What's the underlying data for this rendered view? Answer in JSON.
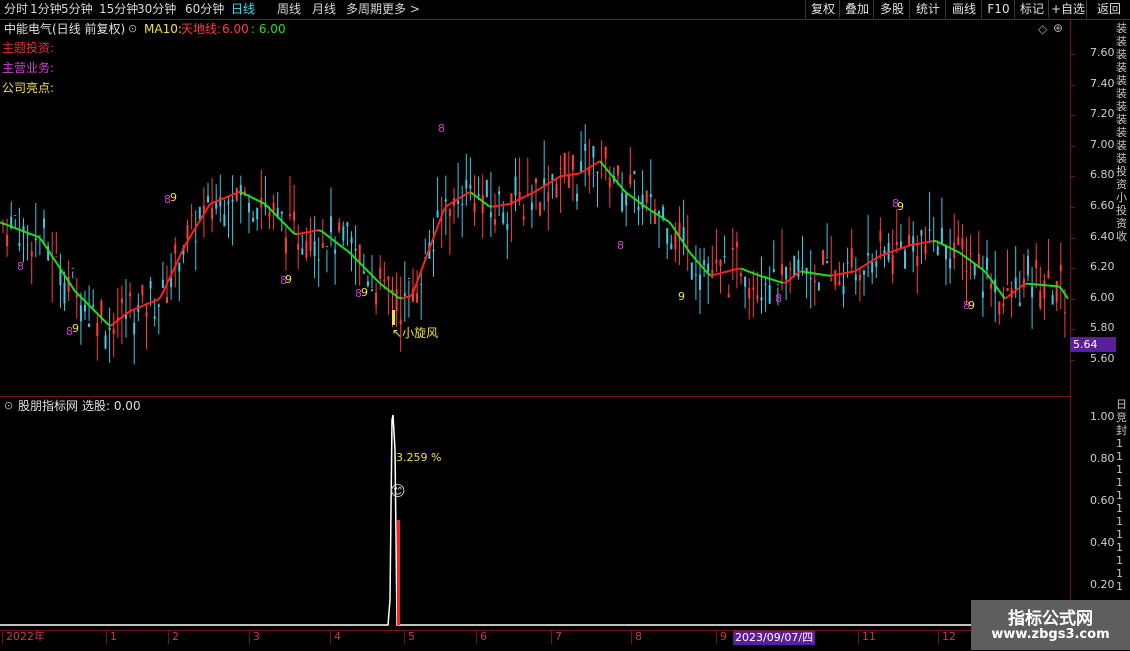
{
  "period_tabs": [
    "分时",
    "1分钟",
    "5分钟",
    "15分钟",
    "30分钟",
    "60分钟",
    "日线",
    "周线",
    "月线",
    "多周期",
    "更多 >"
  ],
  "active_tab_index": 6,
  "right_buttons": [
    "复权",
    "叠加",
    "多股",
    "统计",
    "画线",
    "F10",
    "标记",
    "+自选",
    "返回"
  ],
  "chart_header": {
    "stock": "中能电气(日线 前复权)",
    "indicator": "MA10:",
    "line_name": "天地线:",
    "value_red": "6.00",
    "value_green": ": 6.00"
  },
  "info_labels": [
    {
      "text": "主题投资:",
      "color": "#e03030"
    },
    {
      "text": "主营业务:",
      "color": "#d040d0"
    },
    {
      "text": "公司亮点:",
      "color": "#f0e040"
    }
  ],
  "price_ticks": [
    "7.60",
    "7.40",
    "7.20",
    "7.00",
    "6.80",
    "6.60",
    "6.40",
    "6.20",
    "6.00",
    "5.80",
    "5.60"
  ],
  "last_price": "5.64",
  "annotation": "小旋风",
  "lower_panel": {
    "title": "股朋指标网",
    "select_label": "选股: 0.00",
    "pct_label": "3.259 %",
    "ticks": [
      "1.00",
      "0.80",
      "0.60",
      "0.40",
      "0.20"
    ]
  },
  "time_axis": {
    "start": "2022年",
    "months": [
      "1",
      "2",
      "3",
      "4",
      "5",
      "6",
      "7",
      "8",
      "9",
      "11",
      "12"
    ],
    "cursor_date": "2023/09/07/四"
  },
  "side_text": [
    "装",
    "装",
    "装",
    "装",
    "装",
    "装",
    "装",
    "装",
    "装",
    "装",
    "装",
    "投",
    "资",
    "小",
    "投",
    "资",
    "收"
  ],
  "side_text_lower": [
    "日",
    "竞",
    "封",
    "1",
    "1",
    "1",
    "1",
    "1",
    "1",
    "1",
    "1",
    "1",
    "1",
    "1",
    "1"
  ],
  "watermark": {
    "line1": "指标公式网",
    "line2": "www.zbgs3.com"
  },
  "colors": {
    "up": "#ff3c3c",
    "down": "#40c8e0",
    "ma_up": "#ff2020",
    "ma_down": "#20e020",
    "accent": "#2ee0f0",
    "price_box": "#5a1f9a"
  }
}
